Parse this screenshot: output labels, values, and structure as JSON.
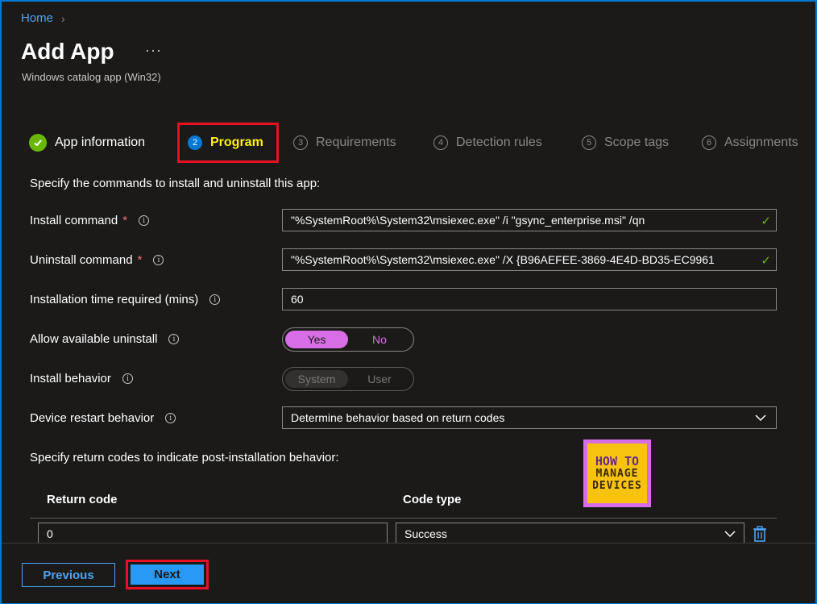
{
  "breadcrumb": {
    "home": "Home",
    "separator": "›"
  },
  "header": {
    "title": "Add App",
    "more": "···",
    "subtitle": "Windows catalog app (Win32)"
  },
  "steps": [
    {
      "number": "",
      "label": "App information",
      "state": "done"
    },
    {
      "number": "2",
      "label": "Program",
      "state": "active"
    },
    {
      "number": "3",
      "label": "Requirements",
      "state": "inactive"
    },
    {
      "number": "4",
      "label": "Detection rules",
      "state": "inactive"
    },
    {
      "number": "5",
      "label": "Scope tags",
      "state": "inactive"
    },
    {
      "number": "6",
      "label": "Assignments",
      "state": "inactive"
    }
  ],
  "form": {
    "intro": "Specify the commands to install and uninstall this app:",
    "install_command": {
      "label": "Install command",
      "required": "*",
      "info": "i",
      "value": "\"%SystemRoot%\\System32\\msiexec.exe\" /i \"gsync_enterprise.msi\" /qn"
    },
    "uninstall_command": {
      "label": "Uninstall command",
      "required": "*",
      "info": "i",
      "value": "\"%SystemRoot%\\System32\\msiexec.exe\" /X {B96AEFEE-3869-4E4D-BD35-EC9961"
    },
    "install_time": {
      "label": "Installation time required (mins)",
      "info": "i",
      "value": "60"
    },
    "allow_uninstall": {
      "label": "Allow available uninstall",
      "info": "i",
      "yes": "Yes",
      "no": "No",
      "selected": "Yes"
    },
    "install_behavior": {
      "label": "Install behavior",
      "info": "i",
      "system": "System",
      "user": "User",
      "selected": "System"
    },
    "restart_behavior": {
      "label": "Device restart behavior",
      "info": "i",
      "value": "Determine behavior based on return codes"
    }
  },
  "return_codes": {
    "intro": "Specify return codes to indicate post-installation behavior:",
    "col_code": "Return code",
    "col_type": "Code type",
    "rows": [
      {
        "code": "0",
        "type": "Success"
      }
    ]
  },
  "logo": {
    "line1": "HOW TO",
    "line2": "MANAGE",
    "line3": "DEVICES"
  },
  "footer": {
    "previous": "Previous",
    "next": "Next"
  },
  "colors": {
    "accent": "#0078d4",
    "toggle_on": "#d86ee5",
    "success": "#6bb700",
    "highlight_border": "#e81123",
    "active_step_text": "#fff200"
  }
}
